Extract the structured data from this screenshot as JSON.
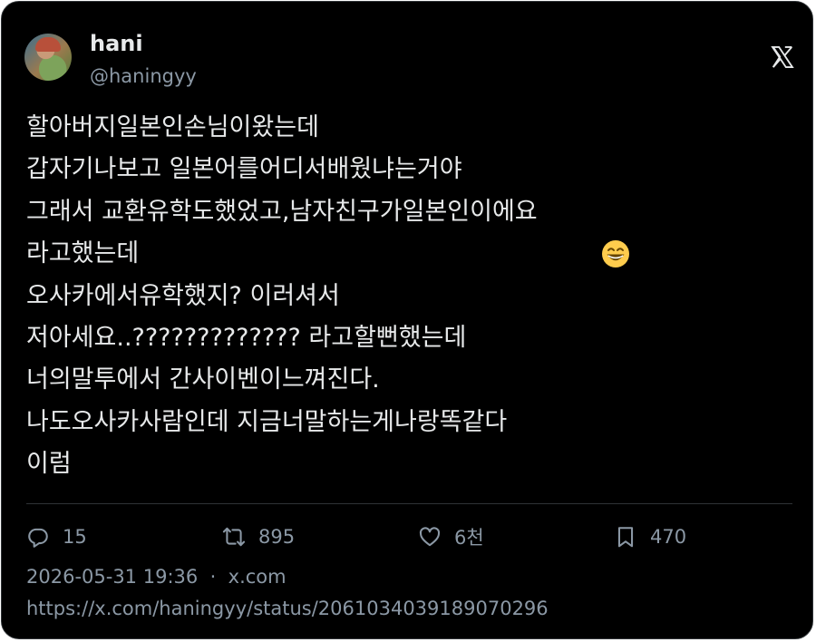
{
  "author": {
    "display_name": "hani",
    "handle": "@haningyy"
  },
  "tweet": {
    "lines": [
      "할아버지일본인손님이왔는데",
      "갑자기나보고 일본어를어디서배웠냐는거야",
      "그래서 교환유학도했었고,남자친구가일본인이에요",
      "라고했는데",
      "오사카에서유학했지? 이러셔서",
      "저아세요..????????????? 라고할뻔했는데",
      "너의말투에서 간사이벤이느껴진다.",
      "나도오사카사람인데 지금너말하는게나랑똑같다",
      "이럼"
    ],
    "emoji_after_line_3": "grinning-face-with-smiling-eyes"
  },
  "actions": {
    "replies": "15",
    "reposts": "895",
    "likes": "6천",
    "bookmarks": "470"
  },
  "meta": {
    "timestamp": "2026-05-31 19:36",
    "separator": "·",
    "source": "x.com",
    "url": "https://x.com/haningyy/status/2061034039189070296"
  },
  "icons": {
    "logo": "x-logo-icon",
    "reply": "reply-icon",
    "repost": "repost-icon",
    "like": "heart-icon",
    "bookmark": "bookmark-icon"
  },
  "colors": {
    "background": "#000000",
    "text": "#e7e9ea",
    "secondary": "#8b98a5",
    "border": "#2f3336"
  }
}
